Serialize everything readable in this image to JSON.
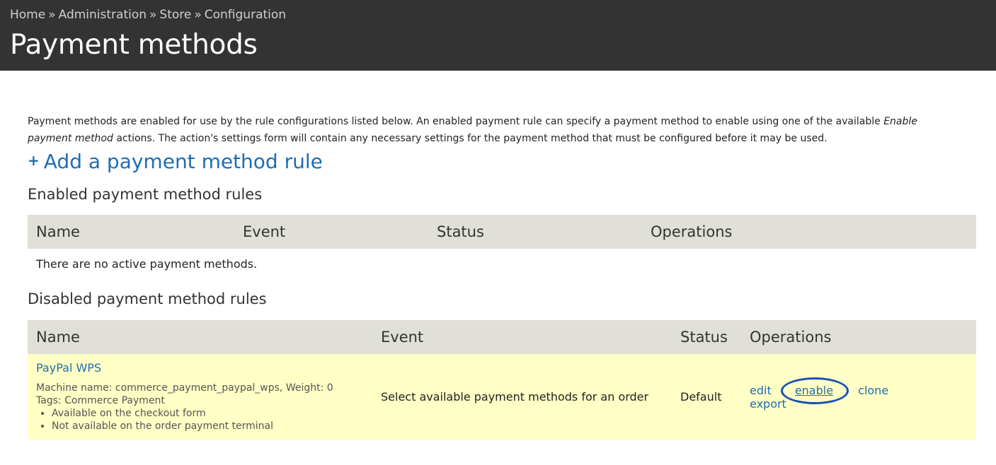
{
  "breadcrumb": {
    "items": [
      "Home",
      "Administration",
      "Store",
      "Configuration"
    ],
    "separator": "»"
  },
  "page_title": "Payment methods",
  "description": {
    "part1": "Payment methods are enabled for use by the rule configurations listed below. An enabled payment rule can specify a payment method to enable using one of the available ",
    "emphasis1": "Enable payment method",
    "part2": " actions. The action's settings form will contain any necessary settings for the payment method that must be configured before it may be used."
  },
  "add_rule": {
    "icon": "plus-icon",
    "label": "Add a payment method rule"
  },
  "enabled_section": {
    "heading": "Enabled payment method rules",
    "columns": [
      "Name",
      "Event",
      "Status",
      "Operations"
    ],
    "empty_message": "There are no active payment methods."
  },
  "disabled_section": {
    "heading": "Disabled payment method rules",
    "columns": [
      "Name",
      "Event",
      "Status",
      "Operations"
    ],
    "rows": [
      {
        "name": "PayPal WPS",
        "machine_line": "Machine name: commerce_payment_paypal_wps, Weight: 0",
        "tags_line": "Tags: Commerce Payment",
        "notes": [
          "Available on the checkout form",
          "Not available on the order payment terminal"
        ],
        "event": "Select available payment methods for an order",
        "status": "Default",
        "ops": {
          "edit": "edit",
          "enable": "enable",
          "clone": "clone",
          "export": "export"
        }
      }
    ]
  },
  "colors": {
    "header_bg": "#333333",
    "link": "#1e6db3",
    "table_header_bg": "#e0e0d8",
    "row_highlight": "#ffffc6",
    "annotation_ring": "#1550b8"
  }
}
